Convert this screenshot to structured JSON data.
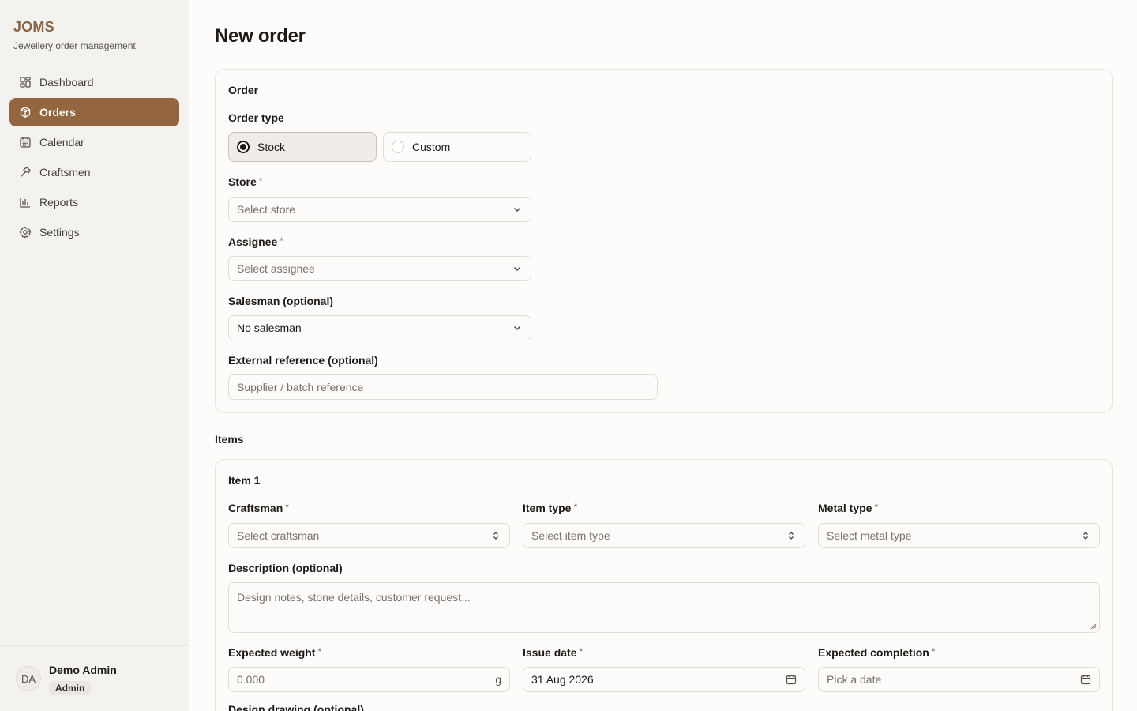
{
  "app": {
    "name": "JOMS",
    "subtitle": "Jewellery order management"
  },
  "sidebar": {
    "items": [
      {
        "label": "Dashboard",
        "icon": "dashboard-icon",
        "active": false
      },
      {
        "label": "Orders",
        "icon": "package-icon",
        "active": true
      },
      {
        "label": "Calendar",
        "icon": "calendar-icon",
        "active": false
      },
      {
        "label": "Craftsmen",
        "icon": "hammer-icon",
        "active": false
      },
      {
        "label": "Reports",
        "icon": "bar-chart-icon",
        "active": false
      },
      {
        "label": "Settings",
        "icon": "gear-icon",
        "active": false
      }
    ],
    "user": {
      "initials": "DA",
      "name": "Demo Admin",
      "role": "Admin"
    }
  },
  "page": {
    "title": "New order"
  },
  "order": {
    "title": "Order",
    "order_type": {
      "label": "Order type",
      "options": [
        "Stock",
        "Custom"
      ],
      "selected": "Stock"
    },
    "store": {
      "label": "Store",
      "required": "*",
      "placeholder": "Select store"
    },
    "assignee": {
      "label": "Assignee",
      "required": "*",
      "placeholder": "Select assignee"
    },
    "salesman": {
      "label": "Salesman (optional)",
      "value": "No salesman"
    },
    "external_ref": {
      "label": "External reference (optional)",
      "placeholder": "Supplier / batch reference"
    }
  },
  "items": {
    "title": "Items",
    "item1": {
      "title": "Item 1",
      "craftsman": {
        "label": "Craftsman",
        "required": "*",
        "placeholder": "Select craftsman"
      },
      "item_type": {
        "label": "Item type",
        "required": "*",
        "placeholder": "Select item type"
      },
      "metal_type": {
        "label": "Metal type",
        "required": "*",
        "placeholder": "Select metal type"
      },
      "description": {
        "label": "Description (optional)",
        "placeholder": "Design notes, stone details, customer request..."
      },
      "expected_weight": {
        "label": "Expected weight",
        "required": "*",
        "placeholder": "0.000",
        "unit": "g"
      },
      "issue_date": {
        "label": "Issue date",
        "required": "*",
        "value": "31 Aug 2026"
      },
      "expected_completion": {
        "label": "Expected completion",
        "required": "*",
        "placeholder": "Pick a date"
      },
      "design_drawing": {
        "label": "Design drawing (optional)"
      }
    }
  },
  "colors": {
    "accent": "#93663f",
    "brand": "#8b6443",
    "background": "#fdfcfa",
    "sidebar": "#f4f2ee"
  }
}
